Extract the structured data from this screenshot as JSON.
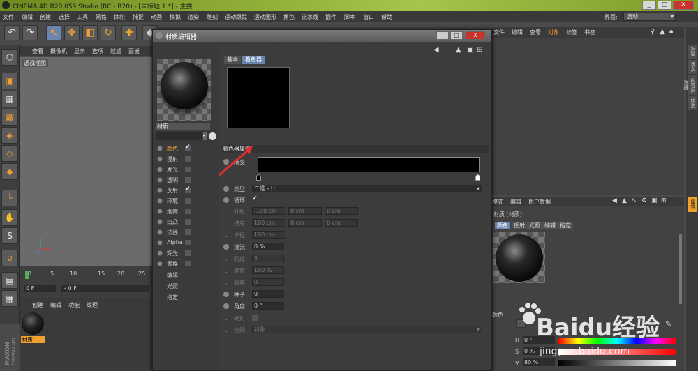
{
  "titlebar": {
    "title": "CINEMA 4D R20.059 Studio (RC - R20) - [未标题 1 *] - 主要"
  },
  "menubar": {
    "items": [
      "文件",
      "编辑",
      "创建",
      "选择",
      "工具",
      "网格",
      "体积",
      "捕捉",
      "动画",
      "模拟",
      "渲染",
      "雕刻",
      "运动跟踪",
      "运动图形",
      "角色",
      "流水线",
      "插件",
      "脚本",
      "窗口",
      "帮助"
    ],
    "layout_label": "界面:",
    "layout_value": "启动"
  },
  "viewport": {
    "menu": [
      "查看",
      "摄像机",
      "显示",
      "选项",
      "过滤",
      "面板"
    ],
    "label": "透视视图"
  },
  "timeline": {
    "ticks": [
      "0",
      "5",
      "10",
      "15",
      "20",
      "25"
    ],
    "frame_a": "0 F",
    "frame_b": "0 F"
  },
  "material_manager": {
    "menu": [
      "创建",
      "编辑",
      "功能",
      "纹理"
    ],
    "material_name": "材质"
  },
  "maxon": {
    "line1": "MAXON",
    "line2": "CINEMA 4D"
  },
  "object_manager": {
    "menu": [
      "文件",
      "编辑",
      "查看",
      "对象",
      "标签",
      "书签"
    ]
  },
  "right_tabs": [
    "对象",
    "场次",
    "内容浏览器",
    "构造"
  ],
  "right_tabs_bottom": [
    "属性"
  ],
  "material_editor": {
    "title": "材质编辑器",
    "buttons": {
      "minimize": "_",
      "maximize": "□",
      "close": "X"
    },
    "material_name": "材质",
    "channels": [
      {
        "label": "颜色",
        "checked": true,
        "active": true
      },
      {
        "label": "漫射",
        "checked": false,
        "active": false
      },
      {
        "label": "发光",
        "checked": false,
        "active": false
      },
      {
        "label": "透明",
        "checked": false,
        "active": false
      },
      {
        "label": "反射",
        "checked": true,
        "active": false
      },
      {
        "label": "环境",
        "checked": false,
        "active": false
      },
      {
        "label": "烟雾",
        "checked": false,
        "active": false
      },
      {
        "label": "凹凸",
        "checked": false,
        "active": false
      },
      {
        "label": "法线",
        "checked": false,
        "active": false
      },
      {
        "label": "Alpha",
        "checked": false,
        "active": false
      },
      {
        "label": "辉光",
        "checked": false,
        "active": false
      },
      {
        "label": "置换",
        "checked": false,
        "active": false
      }
    ],
    "extra_items": [
      "编辑",
      "光照",
      "指定"
    ],
    "tabs": [
      "基本",
      "着色器"
    ],
    "section_title": "着色器属性",
    "props": {
      "gradient_label": "渐变",
      "type_label": "类型",
      "type_value": "二维 - U",
      "cycle_label": "循环",
      "start_label": "开始",
      "start_vals": [
        "-100 cm",
        "0 cm",
        "0 cm"
      ],
      "end_label": "结束",
      "end_vals": [
        "100 cm",
        "0 cm",
        "0 cm"
      ],
      "radius_label": "半径",
      "radius_val": "100 cm",
      "turbulence_label": "湍流",
      "turbulence_val": "0 %",
      "octaves_label": "阶度",
      "octaves_val": "5",
      "scale_label": "缩放",
      "scale_val": "100 %",
      "freq_label": "频率",
      "freq_val": "0",
      "seed_label": "种子",
      "seed_val": "0",
      "angle_label": "角度",
      "angle_val": "0 °",
      "absolute_label": "绝对",
      "space_label": "空间",
      "space_val": "对象"
    }
  },
  "attributes": {
    "menu": [
      "模式",
      "编辑",
      "用户数据"
    ],
    "title": "材质 [材质]",
    "tabs": [
      "颜色",
      "反射",
      "光照",
      "编辑",
      "指定"
    ],
    "color_label": "颜色",
    "hsv": [
      {
        "label": "H",
        "value": "0 °"
      },
      {
        "label": "S",
        "value": "0 %"
      },
      {
        "label": "V",
        "value": "80 %"
      }
    ]
  },
  "watermark": {
    "brand": "Baidu经验",
    "url": "jingyan.baidu.com"
  },
  "colors": {
    "accent": "#f0a030",
    "tab_active": "#6a86b0",
    "title_green": "#8aa832"
  }
}
